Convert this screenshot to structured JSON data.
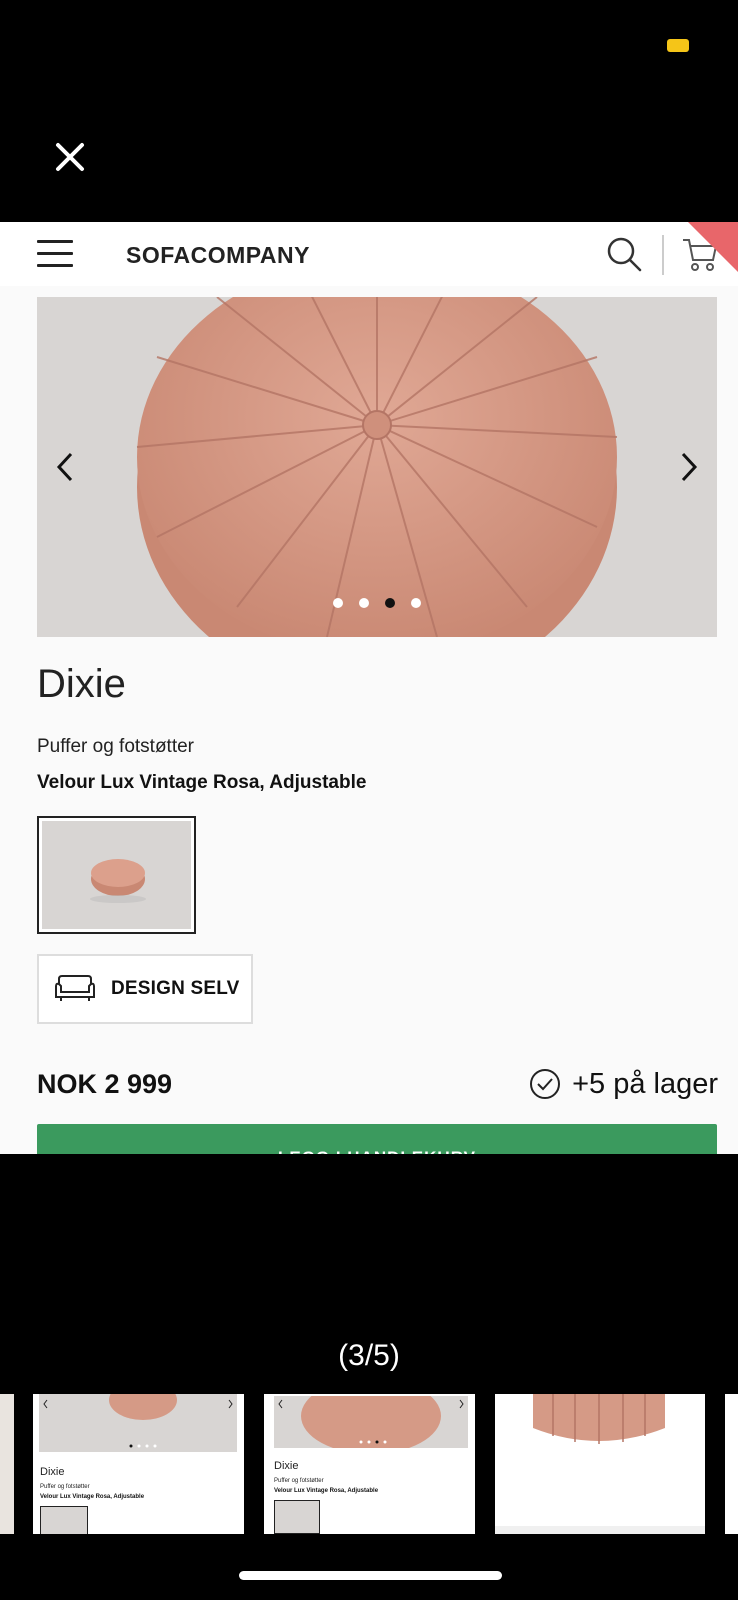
{
  "viewer": {
    "counter": "(3/5)",
    "close_icon": "close-icon",
    "status_indicator_color": "#f5c518"
  },
  "site": {
    "logo": "SOFACOMPANY",
    "menu_icon": "hamburger-menu-icon",
    "search_icon": "search-icon",
    "cart_icon": "cart-icon",
    "accent_color": "#e8666a"
  },
  "gallery": {
    "prev_icon": "chevron-left-icon",
    "next_icon": "chevron-right-icon",
    "slide_count": 4,
    "active_slide": 3
  },
  "product": {
    "title": "Dixie",
    "category": "Puffer og fotstøtter",
    "variant": "Velour Lux Vintage Rosa, Adjustable",
    "design_button": "DESIGN SELV",
    "design_icon": "sofa-icon",
    "price": "NOK 2 999",
    "stock": "+5 på lager",
    "stock_icon": "check-circle-icon",
    "add_to_cart": "LEGG I HANDLEKURV",
    "product_color": "#d59a86",
    "button_color": "#3b9a5e"
  },
  "thumbnails": [
    {
      "title": "Dixie",
      "category": "Puffer og fotstøtter",
      "variant": "Velour Lux Vintage Rosa, Adjustable"
    },
    {
      "title": "Dixie",
      "category": "Puffer og fotstøtter",
      "variant": "Velour Lux Vintage Rosa, Adjustable"
    }
  ]
}
